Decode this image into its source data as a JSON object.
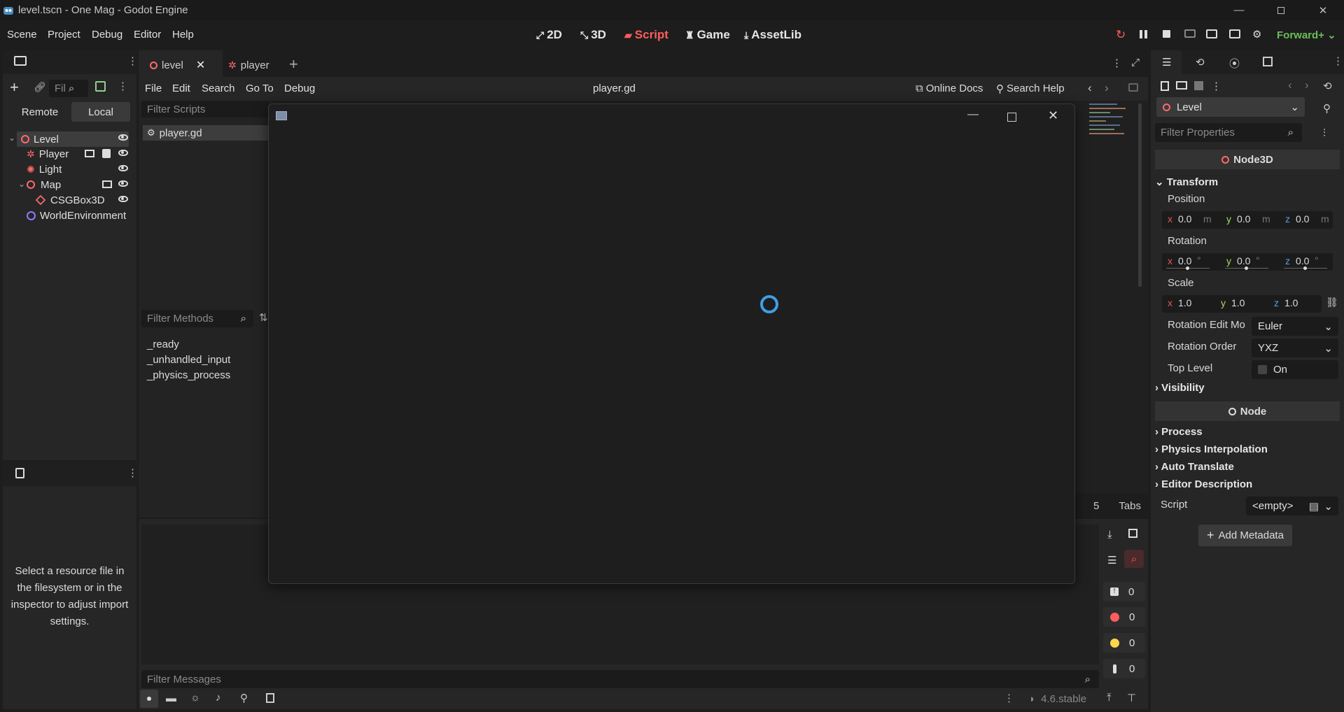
{
  "window": {
    "title": "level.tscn - One Mag - Godot Engine"
  },
  "menu": {
    "items": [
      "Scene",
      "Project",
      "Debug",
      "Editor",
      "Help"
    ]
  },
  "modes": {
    "m2d": "2D",
    "m3d": "3D",
    "script": "Script",
    "game": "Game",
    "assetlib": "AssetLib"
  },
  "renderer": "Forward+",
  "scene_dock": {
    "filter_placeholder": "Fil",
    "remote": "Remote",
    "local": "Local",
    "tree": [
      {
        "label": "Level"
      },
      {
        "label": "Player"
      },
      {
        "label": "Light"
      },
      {
        "label": "Map"
      },
      {
        "label": "CSGBox3D"
      },
      {
        "label": "WorldEnvironment"
      }
    ]
  },
  "import_dock": {
    "message": "Select a resource file in the filesystem or in the inspector to adjust import settings."
  },
  "scene_tabs": [
    {
      "label": "level"
    },
    {
      "label": "player"
    }
  ],
  "script_editor": {
    "menu": [
      "File",
      "Edit",
      "Search",
      "Go To",
      "Debug"
    ],
    "current_file": "player.gd",
    "online_docs": "Online Docs",
    "search_help": "Search Help",
    "filter_scripts": "Filter Scripts",
    "scripts": [
      "player.gd"
    ],
    "filter_methods": "Filter Methods",
    "methods": [
      "_ready",
      "_unhandled_input",
      "_physics_process"
    ],
    "status_num": "5",
    "status_indent": "Tabs"
  },
  "output": {
    "filter_messages": "Filter Messages",
    "counts": [
      "0",
      "0",
      "0",
      "0"
    ],
    "version": "4.6.stable"
  },
  "inspector": {
    "node": "Level",
    "filter_placeholder": "Filter Properties",
    "class_node3d": "Node3D",
    "transform": "Transform",
    "position_label": "Position",
    "position": {
      "x": "0.0",
      "y": "0.0",
      "z": "0.0",
      "unit": "m"
    },
    "rotation_label": "Rotation",
    "rotation": {
      "x": "0.0",
      "y": "0.0",
      "z": "0.0",
      "unit": "°"
    },
    "scale_label": "Scale",
    "scale": {
      "x": "1.0",
      "y": "1.0",
      "z": "1.0"
    },
    "rotation_edit_mode_label": "Rotation Edit Mo",
    "rotation_edit_mode": "Euler",
    "rotation_order_label": "Rotation Order",
    "rotation_order": "YXZ",
    "top_level_label": "Top Level",
    "top_level_value": "On",
    "visibility": "Visibility",
    "class_node": "Node",
    "process": "Process",
    "physics_interp": "Physics Interpolation",
    "auto_translate": "Auto Translate",
    "editor_desc": "Editor Description",
    "script_label": "Script",
    "script_value": "<empty>",
    "add_metadata": "Add Metadata"
  },
  "colors": {
    "accent_red": "#ff5d5d",
    "accent_blue": "#3d9fe8",
    "renderer_green": "#6bbf59"
  }
}
